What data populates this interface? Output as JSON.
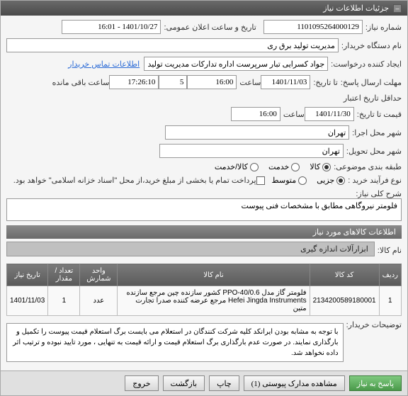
{
  "header": {
    "title": "جزئیات اطلاعات نیاز"
  },
  "labels": {
    "need_no": "شماره نیاز:",
    "pub_datetime": "تاریخ و ساعت اعلان عمومی:",
    "buyer_name": "نام دستگاه خریدار:",
    "requester": "ایجاد کننده درخواست:",
    "contact_link": "اطلاعات تماس خریدار",
    "resp_deadline": "مهلت ارسال پاسخ:",
    "until": "تا تاریخ:",
    "hour": "ساعت",
    "remaining": "ساعت باقی مانده",
    "valid_deadline": "حداقل تاریخ اعتبار",
    "price_until": "قیمت تا تاریخ:",
    "exec_city": "شهر محل اجرا:",
    "deliv_city": "شهر محل تحویل:",
    "category": "طبقه بندی موضوعی:",
    "buy_process": "نوع فرآیند خرید :",
    "payment_note": "پرداخت تمام یا بخشی از مبلغ خرید،از محل \"اسناد خزانه اسلامی\" خواهد بود.",
    "need_desc": "شرح کلی نیاز:",
    "items_section": "اطلاعات کالاهای مورد نیاز",
    "item_name": "نام کالا:",
    "col_row": "ردیف",
    "col_code": "کد کالا",
    "col_name": "نام کالا",
    "col_unit": "واحد شمارش",
    "col_qty": "تعداد / مقدار",
    "col_date": "تاریخ نیاز",
    "buyer_notes": "توضیحات خریدار:",
    "btn_respond": "پاسخ به نیاز",
    "btn_attach": "مشاهده مدارک پیوستی (1)",
    "btn_print": "چاپ",
    "btn_back": "بازگشت",
    "btn_exit": "خروج",
    "cat_goods": "کالا",
    "cat_service": "خدمت",
    "cat_both": "کالا/خدمت",
    "proc_low": "جزیی",
    "proc_mid": "متوسط"
  },
  "values": {
    "need_no": "1101095264000129",
    "pub_datetime": "1401/10/27 - 16:01",
    "buyer_name": "مدیریت تولید برق ری",
    "requester": "جواد کسرایی تبار سرپرست اداره تدارکات مدیریت تولید برق ری",
    "resp_date": "1401/11/03",
    "resp_hour": "16:00",
    "resp_days": "5",
    "remaining_time": "17:26:10",
    "valid_date": "1401/11/30",
    "valid_hour": "16:00",
    "exec_city": "تهران",
    "deliv_city": "تهران",
    "need_desc": "فلومتر نیروگاهی مطابق با مشخصات فنی پیوست",
    "item_name": "ابزارآلات اندازه گیری",
    "buyer_notes": "با توجه به مشابه بودن ایرانکد کلیه شرکت کنندگان در استعلام می بایست برگ استعلام قیمت پیوست را تکمیل و بارگذاری نمایند. در صورت عدم بارگذاری برگ استعلام قیمت و ارائه قیمت به تنهایی ، مورد تایید نبوده و ترتیب اثر داده نخواهد شد."
  },
  "table_rows": [
    {
      "idx": "1",
      "code": "2134200589180001",
      "name": "فلومتر گاز مدل PPO-40/0.6 کشور سازنده چین مرجع سازنده Hefei Jingda Instruments مرجع عرضه کننده صدرا تجارت متین",
      "unit": "عدد",
      "qty": "1",
      "date": "1401/11/03"
    }
  ]
}
